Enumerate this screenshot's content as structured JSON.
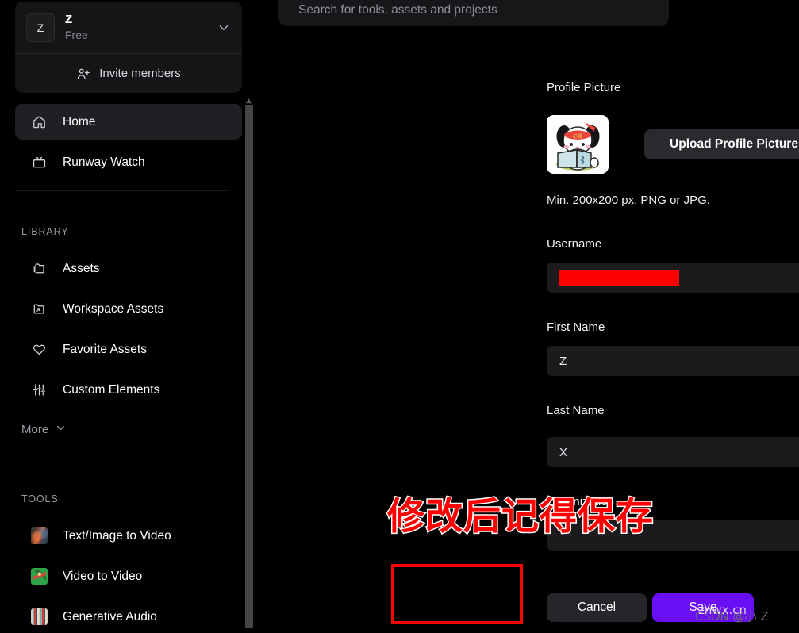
{
  "sidebar": {
    "workspace": {
      "avatar_letter": "Z",
      "name": "Z",
      "plan": "Free",
      "chevron_icon": "chevron-down-icon",
      "invite_label": "Invite members",
      "invite_icon": "person-plus-icon"
    },
    "nav": [
      {
        "label": "Home",
        "icon": "home-icon",
        "active": true
      },
      {
        "label": "Runway Watch",
        "icon": "tv-icon",
        "active": false
      }
    ],
    "library": {
      "section_label": "LIBRARY",
      "items": [
        {
          "label": "Assets",
          "icon": "folder-icon"
        },
        {
          "label": "Workspace Assets",
          "icon": "folder-share-icon"
        },
        {
          "label": "Favorite Assets",
          "icon": "heart-icon"
        },
        {
          "label": "Custom Elements",
          "icon": "sliders-icon"
        }
      ],
      "more_label": "More",
      "more_icon": "chevron-down-icon"
    },
    "tools": {
      "section_label": "TOOLS",
      "items": [
        {
          "label": "Text/Image to Video",
          "icon": "tool-thumbnail-text-image-to-video"
        },
        {
          "label": "Video to Video",
          "icon": "tool-thumbnail-video-to-video"
        },
        {
          "label": "Generative Audio",
          "icon": "tool-thumbnail-generative-audio"
        }
      ]
    }
  },
  "search": {
    "placeholder": "Search for tools, assets and projects",
    "value": ""
  },
  "profile": {
    "picture_label": "Profile Picture",
    "upload_button": "Upload Profile Picture",
    "helper_text": "Min. 200x200 px. PNG or JPG.",
    "avatar_icon": "dog-reading-book-avatar",
    "fields": [
      {
        "label": "Username",
        "value": "",
        "redacted": true
      },
      {
        "label": "First Name",
        "value": "Z",
        "redacted": false
      },
      {
        "label": "Last Name",
        "value": "X",
        "redacted": false
      },
      {
        "label": "Organization",
        "value": "",
        "redacted": false
      }
    ],
    "cancel_button": "Cancel",
    "save_button": "Save"
  },
  "annotations": {
    "callout_text": "修改后记得保存",
    "highlight_color": "#ff0000",
    "accent_color": "#6a0ff5"
  },
  "watermark": {
    "primary": "znwx.cn",
    "secondary": "CSDN @小 Z"
  }
}
